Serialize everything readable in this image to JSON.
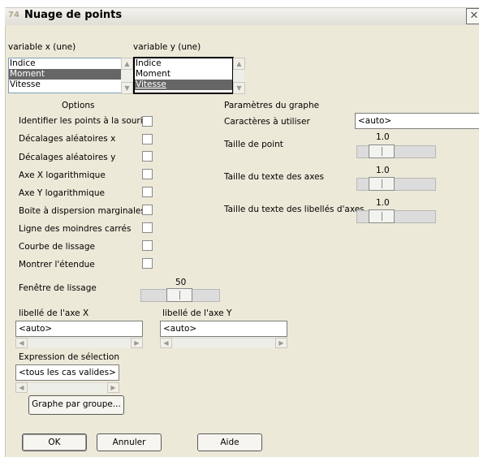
{
  "window": {
    "title": "Nuage de points",
    "icon_text": "74",
    "close_glyph": "✕"
  },
  "variable_x": {
    "label": "variable x (une)",
    "items": [
      "Indice",
      "Moment",
      "Vitesse"
    ],
    "selected": "Moment"
  },
  "variable_y": {
    "label": "variable y (une)",
    "items": [
      "Indice",
      "Moment",
      "Vitesse"
    ],
    "selected": "Vitesse"
  },
  "options": {
    "heading": "Options",
    "items": [
      {
        "label": "Identifier les points à la souris",
        "checked": false
      },
      {
        "label": "Décalages aléatoires x",
        "checked": false
      },
      {
        "label": "Décalages aléatoires y",
        "checked": false
      },
      {
        "label": "Axe X logarithmique",
        "checked": false
      },
      {
        "label": "Axe Y logarithmique",
        "checked": false
      },
      {
        "label": "Boite à dispersion marginales",
        "checked": false
      },
      {
        "label": "Ligne des moindres carrés",
        "checked": false
      },
      {
        "label": "Courbe de lissage",
        "checked": false
      },
      {
        "label": "Montrer l'étendue",
        "checked": false
      }
    ]
  },
  "graph_params": {
    "heading": "Paramètres du graphe",
    "chars_label": "Caractères à utiliser",
    "chars_value": "<auto>",
    "point_size": {
      "label": "Taille de point",
      "value": "1.0"
    },
    "axis_text_size": {
      "label": "Taille du texte des axes",
      "value": "1.0"
    },
    "axis_label_size": {
      "label": "Taille du texte des libellés d'axes",
      "value": "1.0"
    }
  },
  "smoothing": {
    "label": "Fenêtre de lissage",
    "value": "50"
  },
  "x_axis_label": {
    "label": "libellé de l'axe X",
    "value": "<auto>"
  },
  "y_axis_label": {
    "label": "libellé de l'axe Y",
    "value": "<auto>"
  },
  "selection": {
    "label": "Expression de sélection",
    "value": "<tous les cas valides>"
  },
  "buttons": {
    "by_group": "Graphe par groupe...",
    "ok": "OK",
    "cancel": "Annuler",
    "help": "Aide"
  },
  "colors": {
    "dialog_bg": "#ece9d8",
    "selection_bg": "#666666",
    "list_border": "#7f9db9"
  }
}
